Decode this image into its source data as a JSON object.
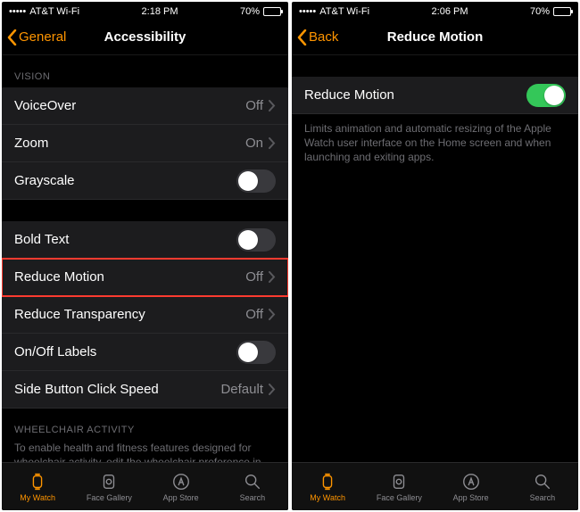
{
  "left": {
    "status": {
      "carrier": "AT&T Wi-Fi",
      "time": "2:18 PM",
      "battery": "70%"
    },
    "nav": {
      "back": "General",
      "title": "Accessibility"
    },
    "sections": {
      "vision_header": "VISION",
      "voiceover": {
        "label": "VoiceOver",
        "value": "Off"
      },
      "zoom": {
        "label": "Zoom",
        "value": "On"
      },
      "grayscale": {
        "label": "Grayscale"
      },
      "bold_text": {
        "label": "Bold Text"
      },
      "reduce_motion": {
        "label": "Reduce Motion",
        "value": "Off"
      },
      "reduce_transparency": {
        "label": "Reduce Transparency",
        "value": "Off"
      },
      "onoff_labels": {
        "label": "On/Off Labels"
      },
      "side_button": {
        "label": "Side Button Click Speed",
        "value": "Default"
      },
      "wheelchair_header": "WHEELCHAIR ACTIVITY",
      "wheelchair_footer": "To enable health and fitness features designed for wheelchair activity, edit the wheelchair preference in the Health section of My Watch."
    },
    "tabs": {
      "my_watch": "My Watch",
      "face_gallery": "Face Gallery",
      "app_store": "App Store",
      "search": "Search"
    }
  },
  "right": {
    "status": {
      "carrier": "AT&T Wi-Fi",
      "time": "2:06 PM",
      "battery": "70%"
    },
    "nav": {
      "back": "Back",
      "title": "Reduce Motion"
    },
    "row": {
      "label": "Reduce Motion"
    },
    "footer": "Limits animation and automatic resizing of the Apple Watch user interface on the Home screen and when launching and exiting apps.",
    "tabs": {
      "my_watch": "My Watch",
      "face_gallery": "Face Gallery",
      "app_store": "App Store",
      "search": "Search"
    }
  }
}
